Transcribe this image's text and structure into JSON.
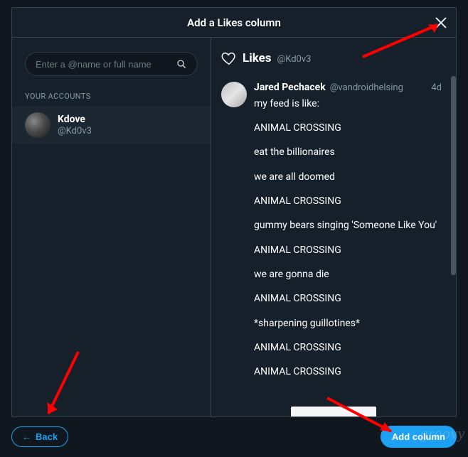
{
  "modal": {
    "title": "Add a Likes column"
  },
  "search": {
    "placeholder": "Enter a @name or full name"
  },
  "accounts": {
    "section_label": "YOUR ACCOUNTS",
    "items": [
      {
        "name": "Kdove",
        "handle": "@Kd0v3"
      }
    ]
  },
  "column": {
    "title": "Likes",
    "handle": "@Kd0v3"
  },
  "tweets": [
    {
      "author": "Jared Pechacek",
      "handle": "@vandroidhelsing",
      "time": "4d",
      "intro": "my feed is like:",
      "lines": [
        "ANIMAL CROSSING",
        "eat the billionaires",
        "we are all doomed",
        "ANIMAL CROSSING",
        "gummy bears singing 'Someone Like You'",
        "ANIMAL CROSSING",
        "we are gonna die",
        "ANIMAL CROSSING",
        "*sharpening guillotines*",
        "ANIMAL CROSSING",
        "ANIMAL CROSSING"
      ]
    }
  ],
  "footer": {
    "back_label": "Back",
    "add_label": "Add column"
  },
  "watermark": "groovy"
}
